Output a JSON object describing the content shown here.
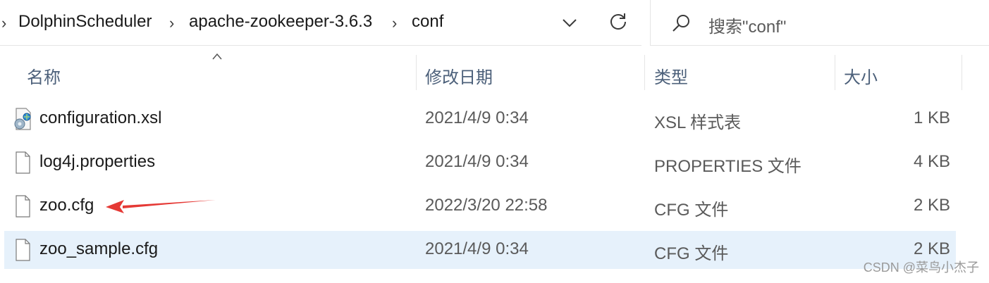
{
  "breadcrumb": {
    "items": [
      "DolphinScheduler",
      "apache-zookeeper-3.6.3",
      "conf"
    ],
    "separator": "›"
  },
  "search": {
    "placeholder": "搜索\"conf\""
  },
  "columns": {
    "name": "名称",
    "date": "修改日期",
    "type": "类型",
    "size": "大小"
  },
  "files": [
    {
      "name": "configuration.xsl",
      "date": "2021/4/9 0:34",
      "type": "XSL 样式表",
      "size": "1 KB",
      "icon": "xsl-file-icon"
    },
    {
      "name": "log4j.properties",
      "date": "2021/4/9 0:34",
      "type": "PROPERTIES 文件",
      "size": "4 KB",
      "icon": "generic-file-icon"
    },
    {
      "name": "zoo.cfg",
      "date": "2022/3/20 22:58",
      "type": "CFG 文件",
      "size": "2 KB",
      "icon": "generic-file-icon"
    },
    {
      "name": "zoo_sample.cfg",
      "date": "2021/4/9 0:34",
      "type": "CFG 文件",
      "size": "2 KB",
      "icon": "generic-file-icon"
    }
  ],
  "selected_row": "zoo_sample.cfg",
  "watermark": "CSDN @菜鸟小杰子",
  "colors": {
    "selection": "#e6f1fb",
    "arrow": "#e53935",
    "header_text": "#4c607a"
  }
}
